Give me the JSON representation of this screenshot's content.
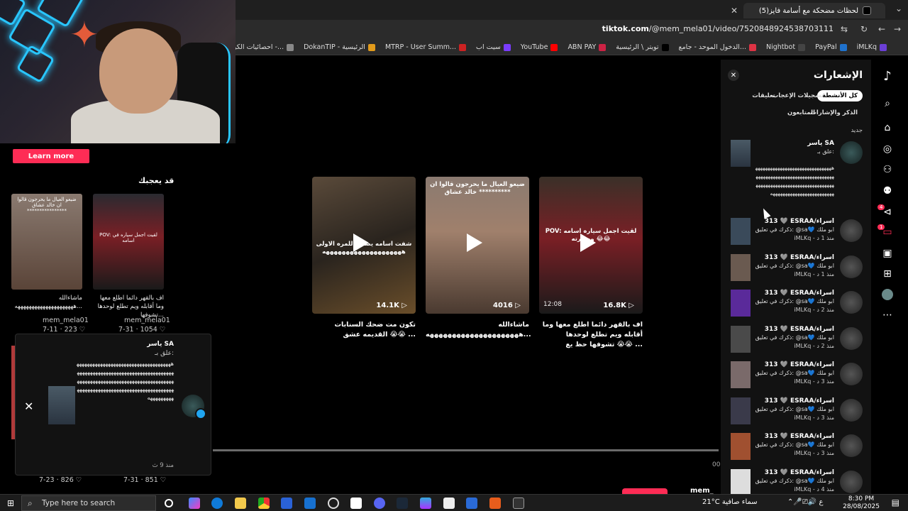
{
  "browser": {
    "tab_title": "(5)لحظات مضحكة مع أسامة فايز",
    "url_domain": "tiktok.com",
    "url_path": "/@mem_mela01/video/7520848924538703111",
    "bookmarks": [
      {
        "label": "iMLKq",
        "color": "#6b3fd6"
      },
      {
        "label": "PayPal",
        "color": "#1f72cd"
      },
      {
        "label": "Nightbot",
        "color": "#444"
      },
      {
        "label": "الدخول الموحد - جامع...",
        "color": "#dd3344"
      },
      {
        "label": "تويتر \\ الرئيسية",
        "color": "#000"
      },
      {
        "label": "ABN PAY",
        "color": "#cc2244"
      },
      {
        "label": "YouTube",
        "color": "#ff0000"
      },
      {
        "label": "سيت اب",
        "color": "#7a3cff"
      },
      {
        "label": "MTRP - User Summ...",
        "color": "#cc2222"
      },
      {
        "label": "DokanTIP - الرئيسية",
        "color": "#e29b1b"
      },
      {
        "label": "احصائيات الكوبون -...",
        "color": "#888"
      },
      {
        "label": "M - احصائيات الكوبون",
        "color": "#d22"
      }
    ]
  },
  "left": {
    "learn_more": "Learn more",
    "may_like": "قد يعجبك",
    "items": [
      {
        "overlay": "ضيعو العيال ما يحرجون قالوا ان خالد عشاق ****************",
        "caption": "ماشاءالله ...هههههههههههههههههههههه",
        "user": "mem_mela01",
        "date": "7-11",
        "likes": "223"
      },
      {
        "overlay": "POV: لقيت اجمل سياره في اسامه",
        "caption": "اف بالقهر دائما اطلع معها وما أقابله ويم تطلع لوحدها تشوفها...",
        "user": "mem_mela01",
        "date": "7-31",
        "likes": "1054"
      }
    ],
    "bottom": [
      {
        "date": "7-23",
        "likes": "826"
      },
      {
        "date": "7-31",
        "likes": "851"
      }
    ]
  },
  "popup": {
    "name": "ياسر SA",
    "subtitle": "علق بـ:",
    "body": "هههههههههههههههههههههههههههههههههههههههههههههههههههههههههههههههههههههههههههههههههههههههههههههههههههههههههههههههههههههههههههههههههههههههههههههههههههههههههههههه",
    "time": "منذ 9 ث"
  },
  "videos": [
    {
      "overlay": "شفت اسامه يضحك للمره الاولى ههههههههههههههههههههه",
      "views": "14.1K",
      "caption": "تكون مت ضحك السنابات القديمه عشق 😭😭 ..."
    },
    {
      "overlay": "ضيعو العيال ما يحرجون قالوا ان خالد عشاق **********",
      "views": "4016",
      "caption": "ماشاءالله ...هههههههههههههههههههههه"
    },
    {
      "overlay": "POV: لقيت اجمل سياره اسامه وصورته 😂😂",
      "views": "16.8K",
      "time": "12:08",
      "caption": "اف بالقهر دائما اطلع معها وما أقابله ويم تطلع لوحدها تشوفها حظ يع 😭😭 ..."
    }
  ],
  "notifications": {
    "title": "الإشعارات",
    "tabs": [
      "كل الأنشطة",
      "تسجيلات الإعجاب",
      "تعليقات",
      "الذكر والإشارات",
      "المتابعون"
    ],
    "new_label": "جديد",
    "first": {
      "name": "ياسر SA",
      "subtitle": "علق بـ:",
      "body": "هههههههههههههههههههههههههههههههههههههههههههههههههههههههههههههههههههههههههههههههههههههههههههههههههههههههههههههههههههههههههه"
    },
    "items": [
      {
        "name": "313 🩶 ESRAA/اسراء",
        "text": "ذكرك في تعليق: @sa💙 ابو ملك",
        "time": "iMLKq - منذ 1 د"
      },
      {
        "name": "313 🩶 ESRAA/اسراء",
        "text": "ذكرك في تعليق: @sa💙 ابو ملك",
        "time": "iMLKq - منذ 1 د"
      },
      {
        "name": "313 🩶 ESRAA/اسراء",
        "text": "ذكرك في تعليق: @sa💙 ابو ملك",
        "time": "iMLKq - منذ 2 د"
      },
      {
        "name": "313 🩶 ESRAA/اسراء",
        "text": "ذكرك في تعليق: @sa💙 ابو ملك",
        "time": "iMLKq - منذ 2 د"
      },
      {
        "name": "313 🩶 ESRAA/اسراء",
        "text": "ذكرك في تعليق: @sa💙 ابو ملك",
        "time": "iMLKq - منذ 3 د"
      },
      {
        "name": "313 🩶 ESRAA/اسراء",
        "text": "ذكرك في تعليق: @sa💙 ابو ملك",
        "time": "iMLKq - منذ 3 د"
      },
      {
        "name": "313 🩶 ESRAA/اسراء",
        "text": "ذكرك في تعليق: @sa💙 ابو ملك",
        "time": "iMLKq - منذ 3 د"
      },
      {
        "name": "313 🩶 ESRAA/اسراء",
        "text": "ذكرك في تعليق: @sa💙 ابو ملك",
        "time": "iMLKq - منذ 4 د"
      }
    ]
  },
  "rail": {
    "badge_inbox": "4",
    "badge_messages": "1"
  },
  "video_player": {
    "time_stub": "00",
    "user_stub": "mem_"
  },
  "taskbar": {
    "search_placeholder": "Type here to search",
    "weather": "21°C سماء صافية",
    "lang": "ع",
    "time": "8:30 PM",
    "date": "28/08/2025"
  },
  "colors": {
    "accent": "#fe2c55",
    "badge": "#20a5f0"
  }
}
